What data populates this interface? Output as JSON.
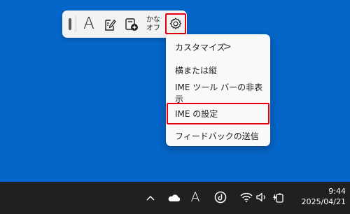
{
  "ime_toolbar": {
    "input_mode_label": "A",
    "kana_lock_line1": "かな",
    "kana_lock_line2": "オフ",
    "icons": [
      "grip-handle",
      "ime-pad-icon",
      "dictionary-icon",
      "gear-icon"
    ]
  },
  "context_menu": {
    "items": [
      {
        "label": "カスタマイズ",
        "has_submenu": true,
        "chevron": ">"
      },
      {
        "label": "横または縦"
      },
      {
        "label": "IME ツール バーの非表示"
      },
      {
        "label": "IME の設定",
        "highlighted": true
      },
      {
        "label": "フィードバックの送信"
      }
    ]
  },
  "taskbar": {
    "ime_indicator": "A",
    "time": "9:44",
    "date": "2025/04/21",
    "icons": [
      "chevron-up-icon",
      "onedrive-cloud-icon",
      "clipchamp-icon",
      "wifi-icon",
      "volume-icon",
      "battery-icon"
    ]
  },
  "colors": {
    "desktop": "#0566c9",
    "taskbar": "#202020",
    "highlight_border": "#e60012",
    "toolbar": "#f3f3f3",
    "menu": "#f9f9f9"
  }
}
